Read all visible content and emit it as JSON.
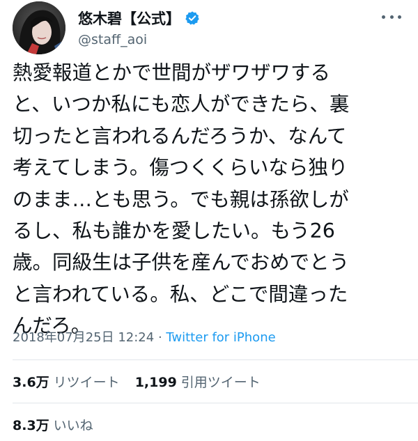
{
  "profile": {
    "display_name": "悠木碧【公式】",
    "handle": "@staff_aoi"
  },
  "icons": {
    "avatar": "avatar-photo",
    "verified": "verified-badge-icon",
    "more": "more-options-icon"
  },
  "colors": {
    "verified_blue": "#1d9bf0",
    "link_blue": "#1d9bf0",
    "secondary_text": "#536471",
    "primary_text": "#0f1419"
  },
  "tweet": {
    "lines": [
      "熱愛報道とかで世間がザワザワする",
      "と、いつか私にも恋人ができたら、裏",
      "切ったと言われるんだろうか、なんて",
      "考えてしまう。傷つくくらいなら独り",
      "のまま…とも思う。でも親は孫欲しが",
      "るし、私も誰かを愛したい。もう26",
      "歳。同級生は子供を産んでおめでとう",
      "と言われている。私、どこで間違った",
      "んだろ。"
    ]
  },
  "meta": {
    "timestamp": "2018年07月25日 12:24",
    "separator": " · ",
    "source": "Twitter for iPhone"
  },
  "stats": {
    "retweets_count": "3.6万",
    "retweets_label": "リツイート",
    "quotes_count": "1,199",
    "quotes_label": "引用ツイート",
    "likes_count": "8.3万",
    "likes_label": "いいね"
  }
}
